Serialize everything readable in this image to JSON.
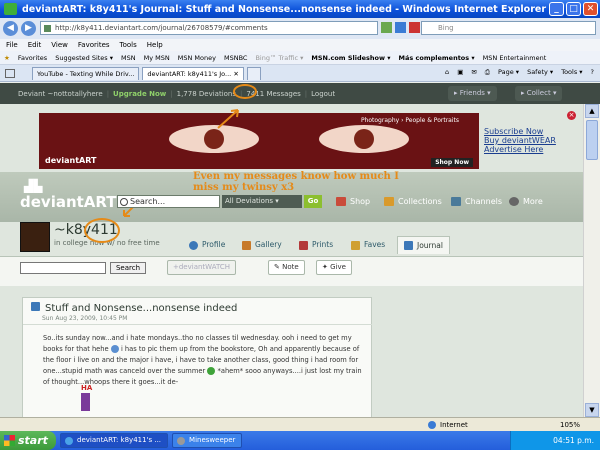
{
  "window": {
    "title": "deviantART: k8y411's Journal: Stuff and Nonsense...nonsense indeed - Windows Internet Explorer"
  },
  "address": {
    "url": "http://k8y411.deviantart.com/journal/26708579/#comments",
    "search_placeholder": "Bing"
  },
  "menu": [
    "File",
    "Edit",
    "View",
    "Favorites",
    "Tools",
    "Help"
  ],
  "favorites_bar": [
    "Favorites",
    "Suggested Sites ▾",
    "MSN",
    "My MSN",
    "MSN Money",
    "MSNBC",
    "Bing™ Traffic ▾",
    "MSN.com Slideshow ▾",
    "Más complementos ▾",
    "MSN Entertainment"
  ],
  "tabs": [
    {
      "label": "YouTube - Texting While Driv..."
    },
    {
      "label": "deviantART: k8y411's Jo..."
    }
  ],
  "toolbar": {
    "page": "Page ▾",
    "safety": "Safety ▾",
    "tools": "Tools ▾"
  },
  "da_bar": {
    "deviant": "Deviant ~nottotallyhere",
    "upgrade": "Upgrade Now",
    "deviations": "1,778 Deviations",
    "messages_count": "7411",
    "messages_label": "Messages",
    "logout": "Logout",
    "friends": "Friends",
    "collect": "Collect"
  },
  "ad": {
    "caption": "Photography › People & Portraits",
    "shop": "Shop Now",
    "logo": "deviantART",
    "links": [
      "Subscribe Now",
      "Buy deviantWEAR",
      "Advertise Here"
    ]
  },
  "header": {
    "logo": "deviantART",
    "annotation": "Even my messages know how much I miss my twinsy  x3",
    "search_value": "Search...",
    "dropdown": "All Deviations",
    "go": "Go",
    "links": [
      "Shop",
      "Collections",
      "Channels",
      "More"
    ]
  },
  "profile": {
    "username": "~k8y411",
    "tagline": "in college now w/ no free time",
    "tabs": [
      "Profile",
      "Gallery",
      "Prints",
      "Faves",
      "Journal"
    ]
  },
  "tools_row": {
    "search_button": "Search",
    "watch": "+deviantWATCH",
    "note": "Note",
    "give": "Give"
  },
  "journal": {
    "title": "Stuff and Nonsense...nonsense indeed",
    "date": "Sun Aug 23, 2009, 10:45 PM",
    "body_1": "So..its sunday now...and i hate mondays..tho no classes til wednesday. ooh i need to get my books for that hehe",
    "body_2": "i has to pic them up from the bookstore, Oh and apparently because of the floor i live on and the major i have, i have to take another class, good thing i had room for one...stupid math was canceld over the summer",
    "body_3": "*ahem* sooo anyways....i just lost my train of thought...whoops there it goes...it de-",
    "ha": "HA"
  },
  "status": {
    "zone": "Internet",
    "zoom": "105%"
  },
  "taskbar": {
    "start": "start",
    "items": [
      "deviantART: k8y411's ...",
      "Minesweeper"
    ],
    "clock": "04:51 p.m."
  }
}
